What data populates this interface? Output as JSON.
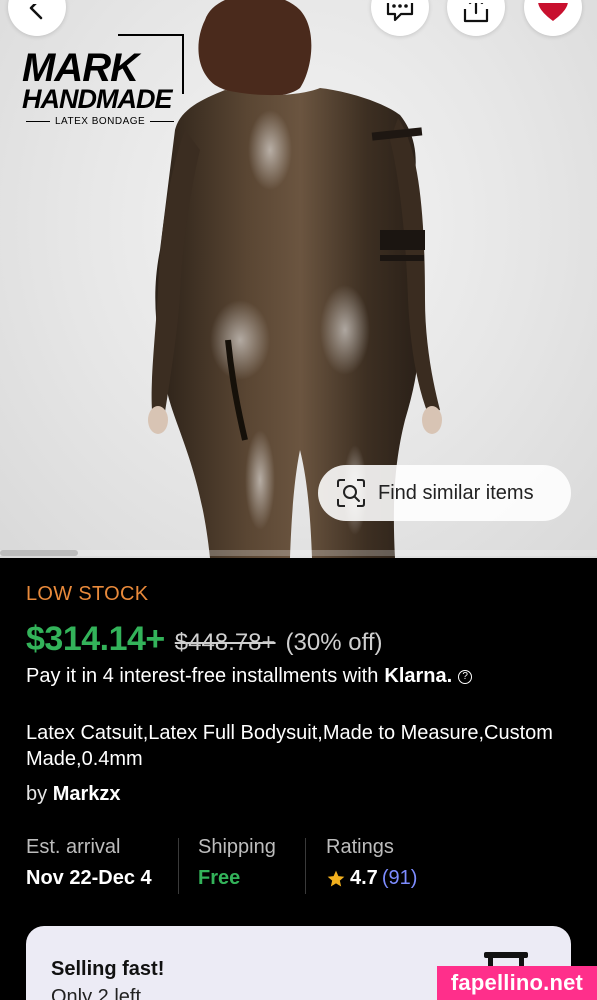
{
  "header": {
    "back_icon": "chevron-left-icon",
    "chat_icon": "message-dots-icon",
    "share_icon": "share-upload-icon",
    "favorite_icon": "heart-icon"
  },
  "hero": {
    "brand_line1": "MARK",
    "brand_line2": "HANDMADE",
    "brand_line3": "LATEX BONDAGE",
    "find_similar_label": "Find similar items",
    "image_progress": 0.13
  },
  "product": {
    "stock_status": "LOW STOCK",
    "price": "$314.14+",
    "original_price": "$448.78+",
    "discount": "(30% off)",
    "installments_text": "Pay it in 4 interest-free installments with",
    "installments_brand": "Klarna.",
    "title": "Latex Catsuit,Latex Full Bodysuit,Made to Measure,Custom Made,0.4mm",
    "seller_prefix": "by",
    "seller_name": "Markzx"
  },
  "stats": {
    "arrival_label": "Est. arrival",
    "arrival_value": "Nov 22-Dec 4",
    "shipping_label": "Shipping",
    "shipping_value": "Free",
    "ratings_label": "Ratings",
    "rating_value": "4.7",
    "rating_count": "(91)"
  },
  "notice": {
    "title": "Selling fast!",
    "subtitle": "Only 2 left"
  },
  "watermark": "fapellino.net",
  "colors": {
    "accent_green": "#33b35a",
    "low_stock_orange": "#e98a3b",
    "rating_link": "#7d8cff",
    "favorite_red": "#c8102e",
    "watermark_pink": "#ff2f8b",
    "notice_bg": "#ecebf5"
  }
}
